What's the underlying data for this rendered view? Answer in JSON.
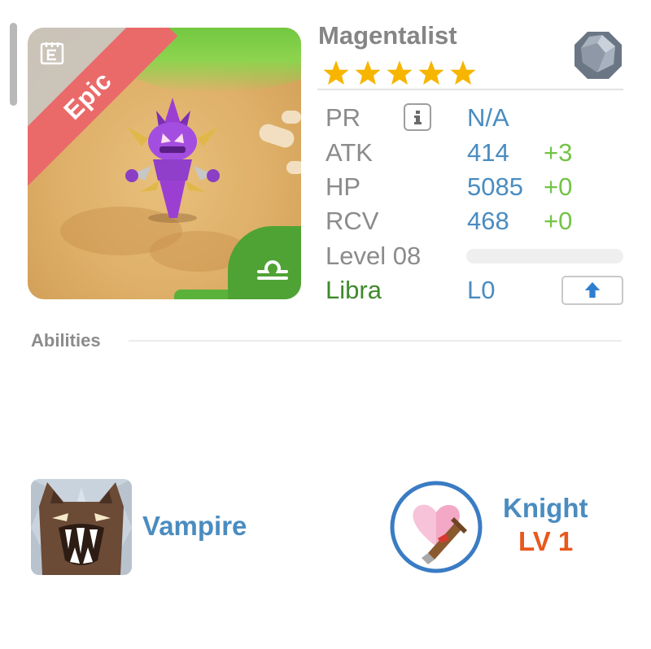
{
  "monster": {
    "name": "Magentalist",
    "rarity": "Epic",
    "star_count": 5,
    "element": "stone",
    "sign_icon": "libra-icon"
  },
  "stats": {
    "pr": {
      "label": "PR",
      "value": "N/A"
    },
    "atk": {
      "label": "ATK",
      "value": "414",
      "bonus": "+3"
    },
    "hp": {
      "label": "HP",
      "value": "5085",
      "bonus": "+0"
    },
    "rcv": {
      "label": "RCV",
      "value": "468",
      "bonus": "+0"
    },
    "level": {
      "label": "Level 08",
      "progress": 0
    },
    "sign": {
      "label": "Libra",
      "value": "L0"
    }
  },
  "abilities": {
    "heading": "Abilities",
    "vampire": {
      "name": "Vampire"
    },
    "knight": {
      "name": "Knight",
      "level": "LV 1"
    }
  },
  "colors": {
    "ribbon": "#ea6a6a",
    "stat_value": "#4a8cc0",
    "stat_bonus": "#72c447",
    "sign_label": "#3f8a2a",
    "knight_level": "#e8581d",
    "star": "#f7b500"
  }
}
